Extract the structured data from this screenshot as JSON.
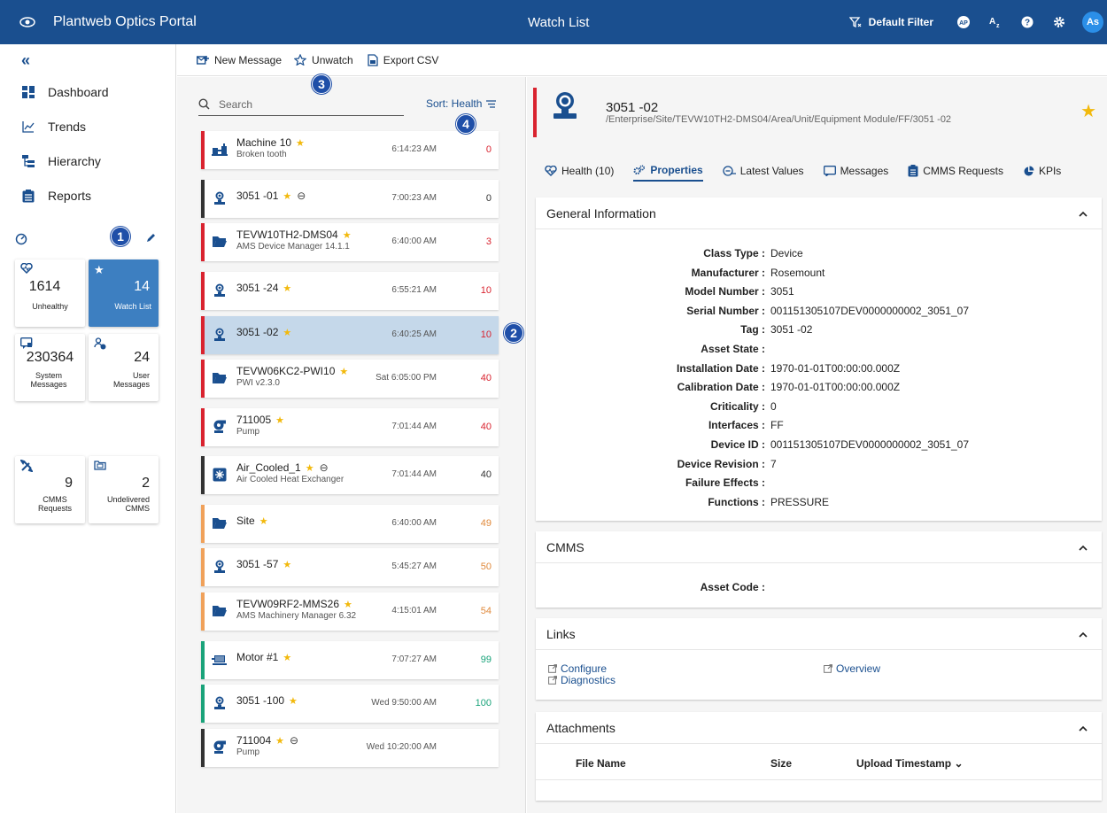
{
  "topbar": {
    "app_title": "Plantweb Optics Portal",
    "page_title": "Watch List",
    "filter_label": "Default Filter",
    "ap_label": "AP",
    "avatar": "As"
  },
  "sidebar": {
    "nav": [
      {
        "label": "Dashboard",
        "icon": "dashboard-icon"
      },
      {
        "label": "Trends",
        "icon": "trends-icon"
      },
      {
        "label": "Hierarchy",
        "icon": "hierarchy-icon"
      },
      {
        "label": "Reports",
        "icon": "reports-icon"
      }
    ],
    "tiles": [
      {
        "value": "1614",
        "label": "Unhealthy",
        "icon": "heart-icon"
      },
      {
        "value": "14",
        "label": "Watch List",
        "icon": "star-icon"
      },
      {
        "value": "230364",
        "label": "System Messages",
        "icon": "message-icon"
      },
      {
        "value": "24",
        "label": "User Messages",
        "icon": "users-icon"
      },
      {
        "value": "9",
        "label": "CMMS Requests",
        "icon": "tools-icon"
      },
      {
        "value": "2",
        "label": "Undelivered CMMS",
        "icon": "folder-icon"
      }
    ]
  },
  "toolbar": {
    "new_message": "New Message",
    "unwatch": "Unwatch",
    "export_csv": "Export CSV"
  },
  "list": {
    "search_placeholder": "Search",
    "sort_label": "Sort: Health",
    "rows": [
      {
        "name": "Machine 10",
        "sub": "Broken tooth",
        "time": "6:14:23 AM",
        "value": "0",
        "icon": "machine-icon"
      },
      {
        "name": "3051 -01",
        "sub": "",
        "time": "7:00:23 AM",
        "value": "0",
        "icon": "transmitter-icon"
      },
      {
        "name": "TEVW10TH2-DMS04",
        "sub": "AMS Device Manager 14.1.1",
        "time": "6:40:00 AM",
        "value": "3",
        "icon": "folder-icon"
      },
      {
        "name": "3051 -24",
        "sub": "",
        "time": "6:55:21 AM",
        "value": "10",
        "icon": "transmitter-icon"
      },
      {
        "name": "3051 -02",
        "sub": "",
        "time": "6:40:25 AM",
        "value": "10",
        "icon": "transmitter-icon"
      },
      {
        "name": "TEVW06KC2-PWI10",
        "sub": "PWI v2.3.0",
        "time": "Sat 6:05:00 PM",
        "value": "40",
        "icon": "folder-icon"
      },
      {
        "name": "711005",
        "sub": "Pump",
        "time": "7:01:44 AM",
        "value": "40",
        "icon": "pump-icon"
      },
      {
        "name": "Air_Cooled_1",
        "sub": "Air Cooled Heat Exchanger",
        "time": "7:01:44 AM",
        "value": "40",
        "icon": "fan-icon"
      },
      {
        "name": "Site",
        "sub": "",
        "time": "6:40:00 AM",
        "value": "49",
        "icon": "folder-icon"
      },
      {
        "name": "3051 -57",
        "sub": "",
        "time": "5:45:27 AM",
        "value": "50",
        "icon": "transmitter-icon"
      },
      {
        "name": "TEVW09RF2-MMS26",
        "sub": "AMS Machinery Manager 6.32",
        "time": "4:15:01 AM",
        "value": "54",
        "icon": "folder-icon"
      },
      {
        "name": "Motor #1",
        "sub": "",
        "time": "7:07:27 AM",
        "value": "99",
        "icon": "motor-icon"
      },
      {
        "name": "3051 -100",
        "sub": "",
        "time": "Wed 9:50:00 AM",
        "value": "100",
        "icon": "transmitter-icon"
      },
      {
        "name": "711004",
        "sub": "Pump",
        "time": "Wed 10:20:00 AM",
        "value": "",
        "icon": "pump-icon"
      }
    ]
  },
  "badges": [
    "1",
    "2",
    "3",
    "4"
  ],
  "detail": {
    "title": "3051 -02",
    "path": "/Enterprise/Site/TEVW10TH2-DMS04/Area/Unit/Equipment Module/FF/3051 -02",
    "tabs": [
      "Health (10)",
      "Properties",
      "Latest Values",
      "Messages",
      "CMMS Requests",
      "KPIs"
    ],
    "general": {
      "title": "General Information",
      "fields": [
        {
          "k": "Class Type :",
          "v": "Device"
        },
        {
          "k": "Manufacturer :",
          "v": "Rosemount"
        },
        {
          "k": "Model Number :",
          "v": "3051"
        },
        {
          "k": "Serial Number :",
          "v": "001151305107DEV0000000002_3051_07"
        },
        {
          "k": "Tag :",
          "v": "3051 -02"
        },
        {
          "k": "Asset State :",
          "v": ""
        },
        {
          "k": "Installation Date :",
          "v": "1970-01-01T00:00:00.000Z"
        },
        {
          "k": "Calibration Date :",
          "v": "1970-01-01T00:00:00.000Z"
        },
        {
          "k": "Criticality :",
          "v": "0"
        },
        {
          "k": "Interfaces :",
          "v": "FF"
        },
        {
          "k": "Device ID :",
          "v": "001151305107DEV0000000002_3051_07"
        },
        {
          "k": "Device Revision :",
          "v": "7"
        },
        {
          "k": "Failure Effects :",
          "v": ""
        },
        {
          "k": "Functions :",
          "v": "PRESSURE"
        }
      ]
    },
    "cmms": {
      "title": "CMMS",
      "asset_code_label": "Asset Code :",
      "asset_code": ""
    },
    "links": {
      "title": "Links",
      "configure": "Configure",
      "diagnostics": "Diagnostics",
      "overview": "Overview"
    },
    "attachments": {
      "title": "Attachments",
      "col_file": "File Name",
      "col_size": "Size",
      "col_ts": "Upload Timestamp ⌄"
    }
  },
  "colors": {
    "brand": "#1a4f8f",
    "red": "#d9232f",
    "dark": "#333333",
    "orange": "#f0a15a",
    "green": "#1aa37a",
    "star": "#f2b90c"
  }
}
